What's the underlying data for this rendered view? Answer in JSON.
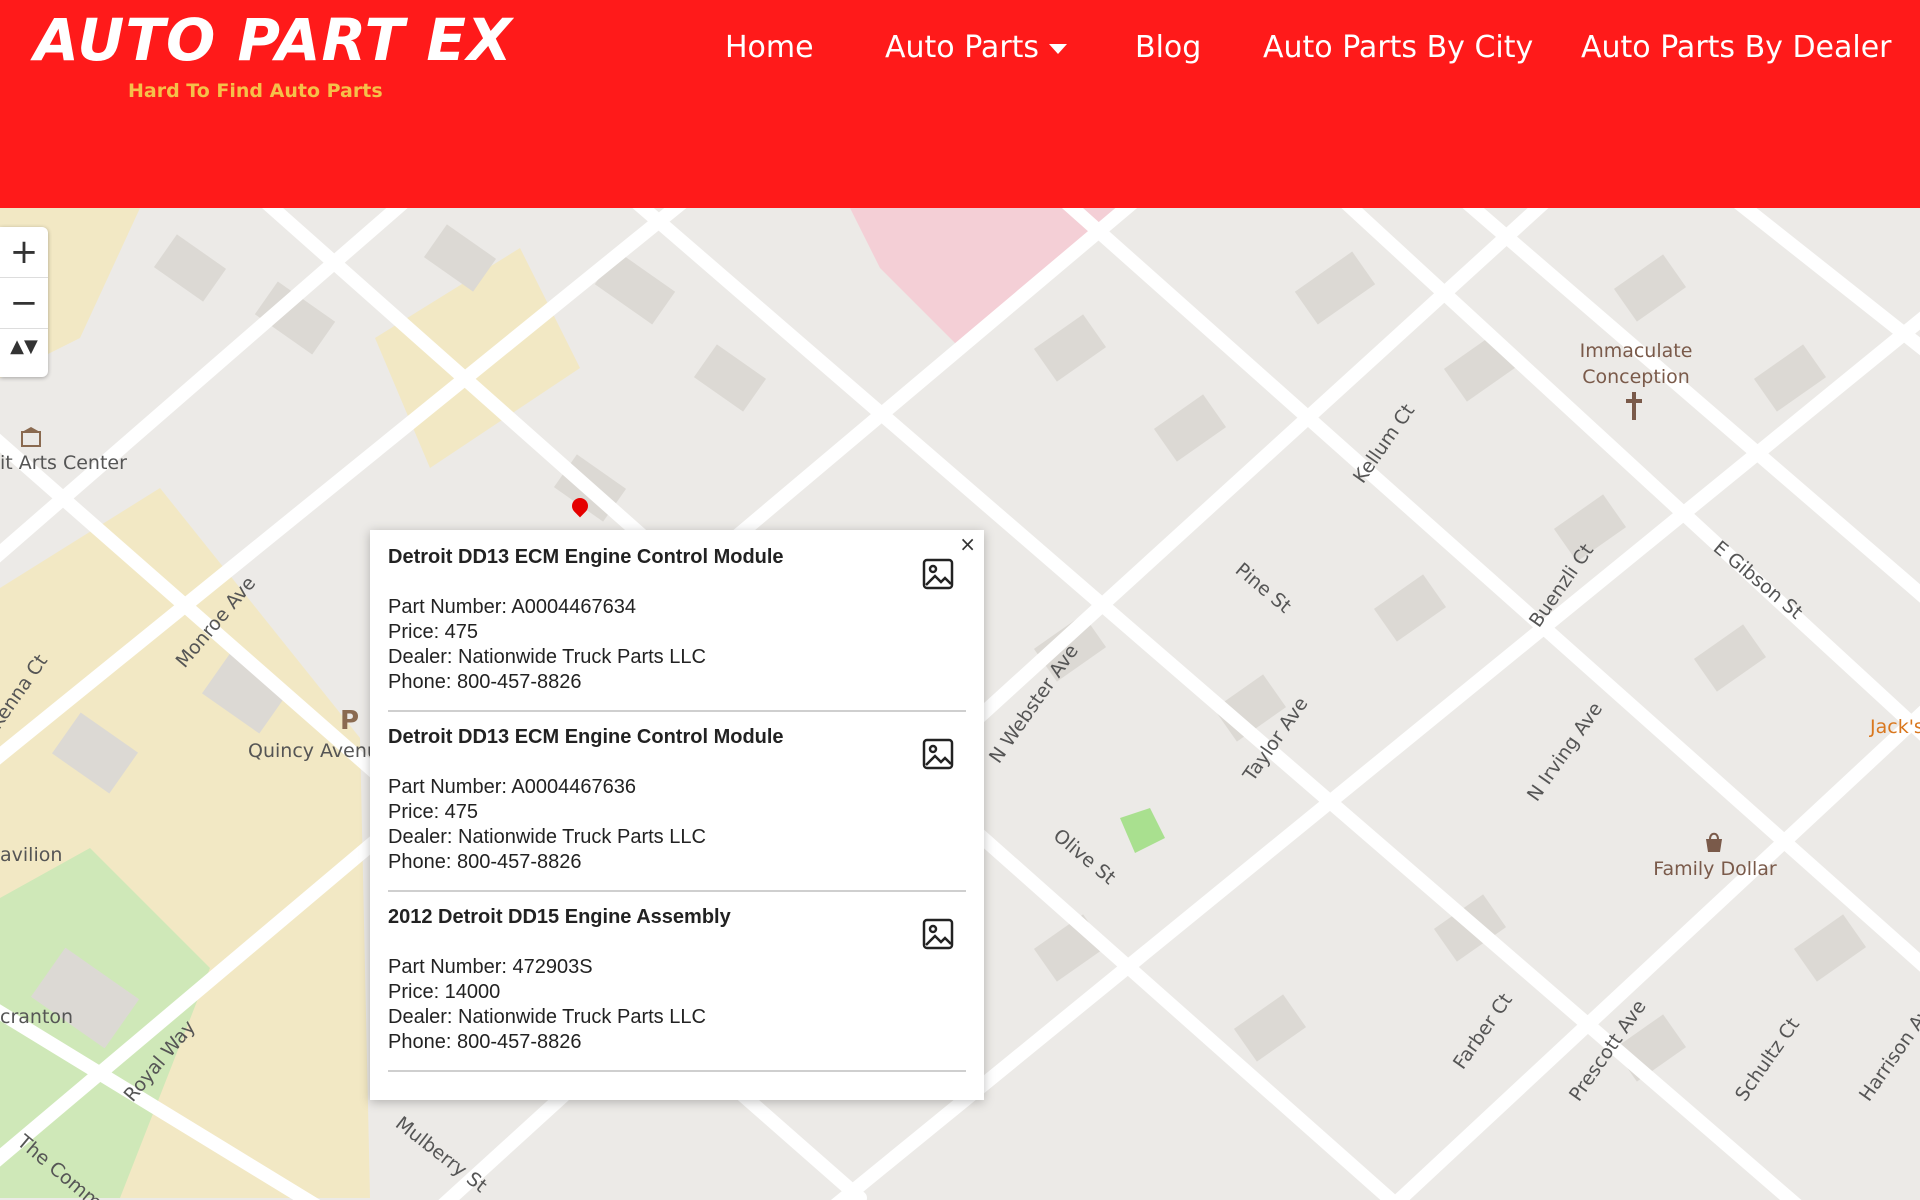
{
  "header": {
    "logo_title": "AUTO PART EX",
    "logo_tagline": "Hard To Find Auto Parts",
    "nav": {
      "home": "Home",
      "auto_parts": "Auto Parts",
      "blog": "Blog",
      "by_city": "Auto Parts By City",
      "by_dealer": "Auto Parts By Dealer"
    }
  },
  "map_controls": {
    "zoom_in": "+",
    "zoom_out": "−",
    "compass": "▲▼"
  },
  "popup": {
    "close": "×",
    "items": [
      {
        "title": "Detroit DD13 ECM Engine Control Module",
        "part_number": "Part Number: A0004467634",
        "price": "Price: 475",
        "dealer": "Dealer: Nationwide Truck Parts LLC",
        "phone": "Phone: 800-457-8826"
      },
      {
        "title": "Detroit DD13 ECM Engine Control Module",
        "part_number": "Part Number: A0004467636",
        "price": "Price: 475",
        "dealer": "Dealer: Nationwide Truck Parts LLC",
        "phone": "Phone: 800-457-8826"
      },
      {
        "title": "2012 Detroit DD15 Engine Assembly",
        "part_number": "Part Number: 472903S",
        "price": "Price: 14000",
        "dealer": "Dealer: Nationwide Truck Parts LLC",
        "phone": "Phone: 800-457-8826"
      }
    ]
  },
  "map_labels": {
    "arts_center": "it Arts Center",
    "monroe": "Monroe Ave",
    "quincy": "Quincy Avenue",
    "parking": "P",
    "kenna": "Kenna Ct",
    "pavilion": "avilion",
    "cranton": "cranton",
    "royal_way": "Royal Way",
    "commons": "The Commons",
    "mulberry": "Mulberry St",
    "webster": "N Webster Ave",
    "olive": "Olive St",
    "taylor": "Taylor Ave",
    "pine": "Pine St",
    "kellum": "Kellum Ct",
    "immaculate": "Immaculate",
    "conception": "Conception",
    "buenzli": "Buenzli Ct",
    "gibson": "E Gibson St",
    "irving": "N Irving Ave",
    "family_dollar": "Family Dollar",
    "jacks": "Jack's",
    "farber": "Farber Ct",
    "prescott": "Prescott Ave",
    "schultz": "Schultz Ct",
    "harrison": "Harrison Ave"
  }
}
